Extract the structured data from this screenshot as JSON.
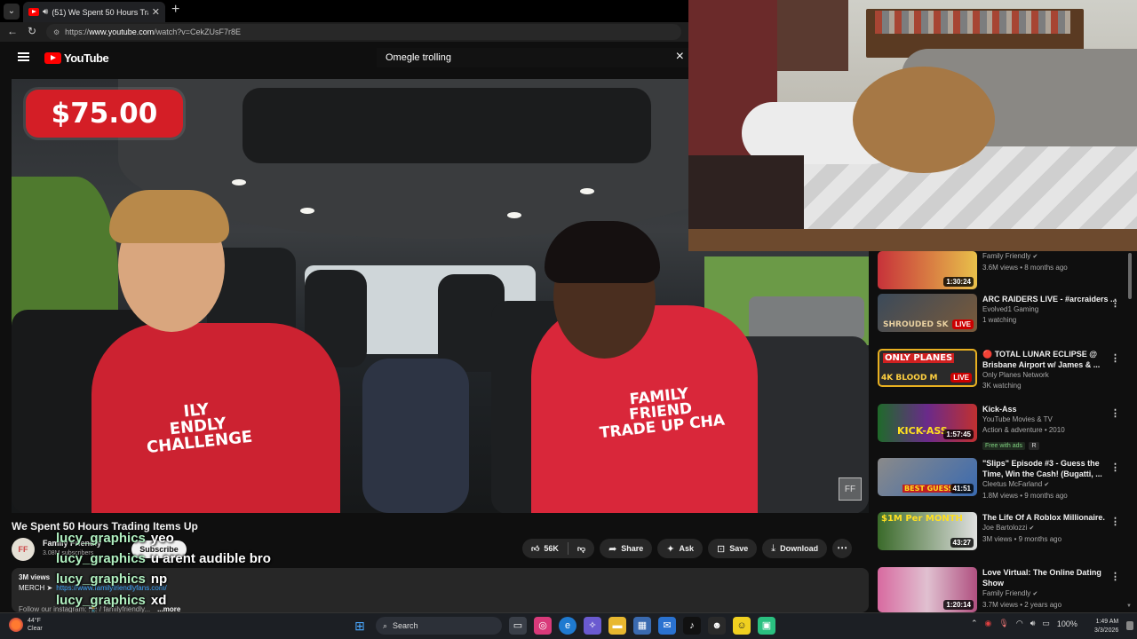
{
  "browser": {
    "tab_title": "(51) We Spent 50 Hours Trading",
    "url_prefix": "https://",
    "url_host": "www.youtube.com",
    "url_path": "/watch?v=CekZUsF7r8E"
  },
  "youtube": {
    "logo_text": "YouTube",
    "search_query": "Omegle trolling"
  },
  "video": {
    "price_overlay": "$75.00",
    "shirt_logo_left": "ILY\nENDLY\nCHALLENGE",
    "shirt_logo_right": "FAMILY\nFRIEND\nTRADE UP CHA",
    "watermark": "FF"
  },
  "watch": {
    "title": "We Spent 50 Hours Trading Items Up",
    "channel_name": "Family Friendly",
    "channel_subs": "3.08M subscribers",
    "subscribe_label": "Subscribe",
    "likes": "56K",
    "share_label": "Share",
    "ask_label": "Ask",
    "save_label": "Save",
    "download_label": "Download",
    "desc_views": "3M views",
    "desc_merch_label": "MERCH ➤",
    "desc_merch_link": "https://www.familyfriendlyfans.com/",
    "desc_follow": "Follow our instagram: 📸 / familyfriendly...",
    "desc_more": "...more"
  },
  "chat": [
    {
      "user": "lucy_graphics",
      "msg": "yeo"
    },
    {
      "user": "lucy_graphics",
      "msg": "u arent audible bro"
    },
    {
      "user": "lucy_graphics",
      "msg": "np"
    },
    {
      "user": "lucy_graphics",
      "msg": "xd"
    },
    {
      "user": "lucy_graphics",
      "msg": "carry"
    }
  ],
  "recommended": [
    {
      "title": "",
      "channel": "Family Friendly",
      "meta": "3.6M views • 8 months ago",
      "duration": "1:30:24",
      "colors": [
        "#c7323a",
        "#e8c04a"
      ]
    },
    {
      "title": "ARC RAIDERS LIVE - #arcraiders ...",
      "channel": "Evolved1 Gaming",
      "meta": "1 watching",
      "live": "LIVE",
      "thumb_text": "SHROUDED SK",
      "colors": [
        "#3b4a5a",
        "#7a5a3a"
      ]
    },
    {
      "title": "🔴 TOTAL LUNAR ECLIPSE @ Brisbane Airport w/ James & ...",
      "channel": "Only Planes Network",
      "meta": "3K watching",
      "live": "LIVE",
      "thumb_text": "ONLY PLANES",
      "thumb_text2": "4K  BLOOD M",
      "colors": [
        "#e8b020",
        "#2a2a2a"
      ]
    },
    {
      "title": "Kick-Ass",
      "channel": "YouTube Movies & TV",
      "meta": "Action & adventure • 2010",
      "badge": "Free with ads",
      "badge2": "R",
      "duration": "1:57:45",
      "thumb_text": "KICK-ASS",
      "colors": [
        "#1f6a2a",
        "#6a2a8a"
      ]
    },
    {
      "title": "\"Slips\" Episode #3 - Guess the Time, Win the Cash! (Bugatti, ...",
      "channel": "Cleetus McFarland",
      "meta": "1.8M views • 9 months ago",
      "duration": "41:51",
      "thumb_text": "BEST GUESS",
      "colors": [
        "#8a8a8a",
        "#3a6ab0"
      ]
    },
    {
      "title": "The Life Of A Roblox Millionaire.",
      "channel": "Joe Bartolozzi",
      "meta": "3M views • 9 months ago",
      "duration": "43:27",
      "thumb_text": "$1M Per MONTH",
      "colors": [
        "#3a6a2a",
        "#e0e0e0"
      ]
    },
    {
      "title": "Love Virtual: The Online Dating Show",
      "channel": "Family Friendly",
      "meta": "3.7M views • 2 years ago",
      "duration": "1:20:14",
      "colors": [
        "#d86aa0",
        "#e0c0d0"
      ]
    }
  ],
  "taskbar": {
    "temp": "44°F",
    "condition": "Clear",
    "search_label": "Search",
    "battery": "100%",
    "time": "1:49 AM",
    "date": "3/3/2026"
  }
}
